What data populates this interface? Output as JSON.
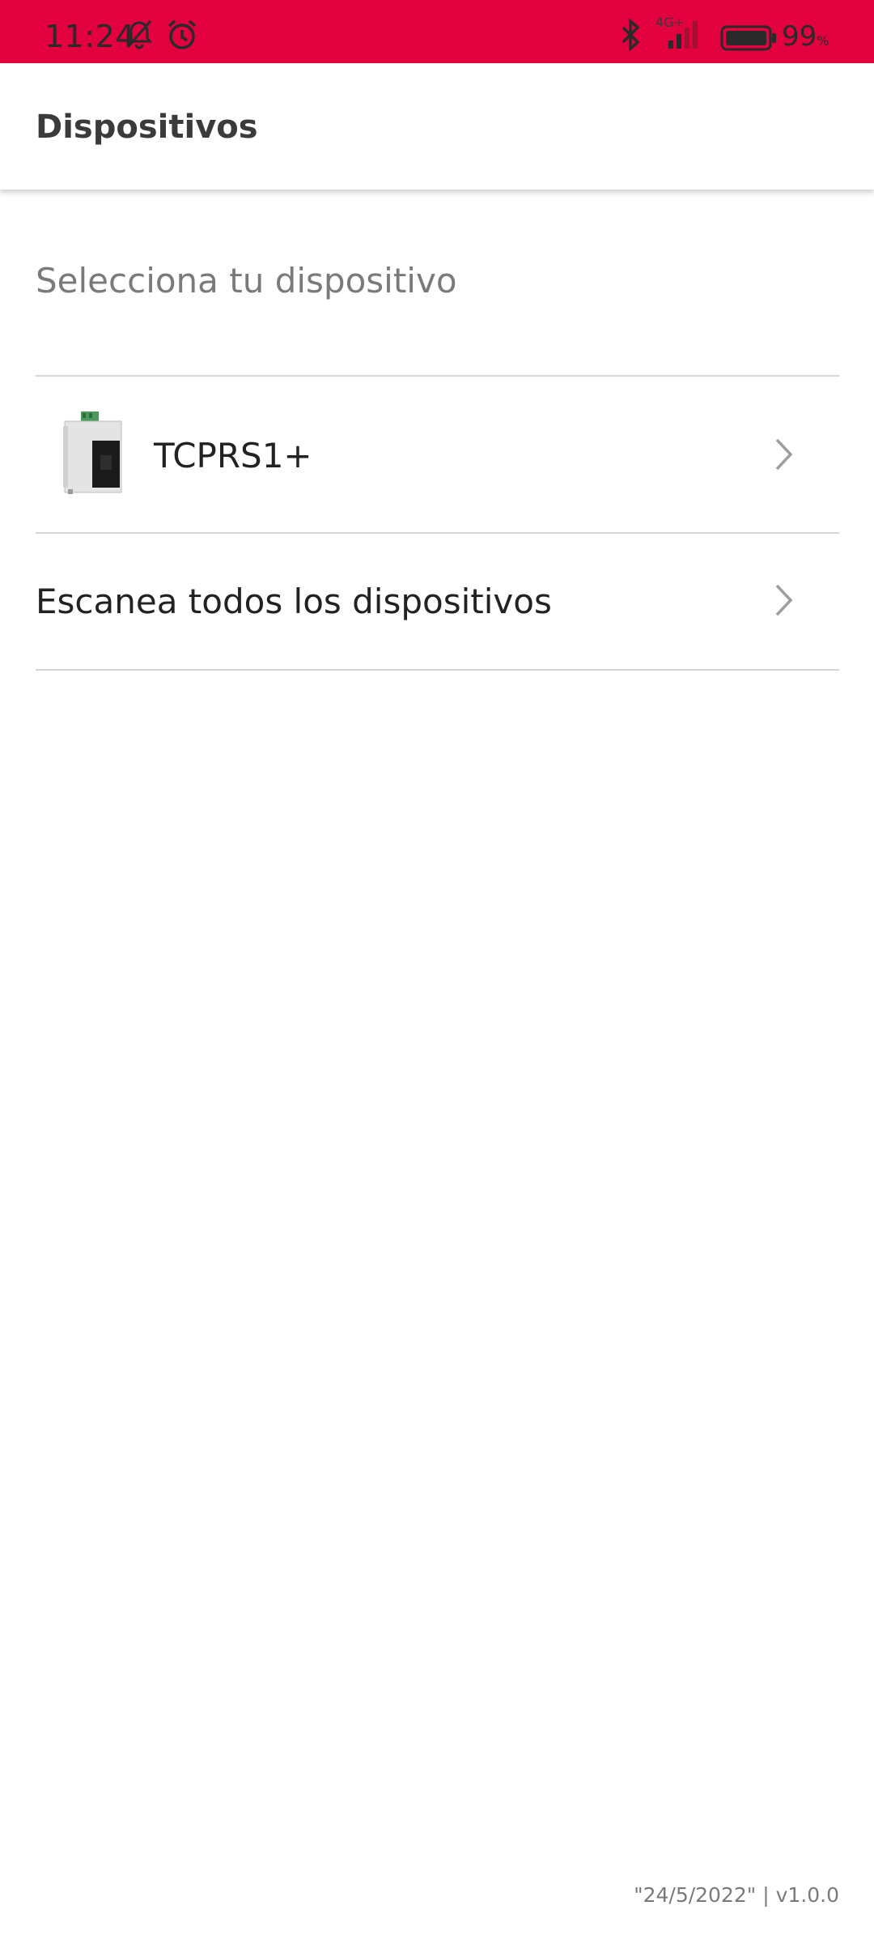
{
  "status_bar": {
    "time": "11:24",
    "network": "4G+",
    "battery_percent": "99",
    "battery_unit": "%",
    "bg_color": "#e2003f",
    "icons": [
      "bell-muted-icon",
      "alarm-icon",
      "bluetooth-icon",
      "signal-icon",
      "battery-icon"
    ]
  },
  "app_bar": {
    "title": "Dispositivos"
  },
  "main": {
    "subtitle": "Selecciona tu dispositivo",
    "items": [
      {
        "label": "TCPRS1+",
        "icon": "device-thumbnail",
        "action_icon": "chevron-right-icon"
      },
      {
        "label": "Escanea todos los dispositivos",
        "action_icon": "chevron-right-icon"
      }
    ]
  },
  "footer": {
    "version": "\"24/5/2022\" | v1.0.0"
  }
}
